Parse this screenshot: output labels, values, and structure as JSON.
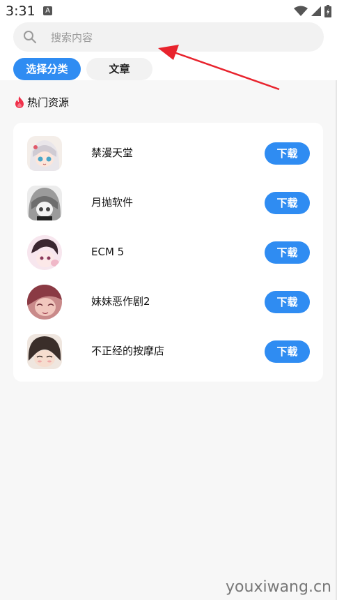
{
  "status_bar": {
    "time": "3:31",
    "notif_letter": "A"
  },
  "search": {
    "placeholder": "搜索内容",
    "value": ""
  },
  "tabs": [
    {
      "label": "选择分类",
      "active": true
    },
    {
      "label": "文章",
      "active": false
    }
  ],
  "hot": {
    "title": "热门资源",
    "items": [
      {
        "name": "禁漫天堂",
        "button": "下载"
      },
      {
        "name": "月抛软件",
        "button": "下载"
      },
      {
        "name": "ECM 5",
        "button": "下载"
      },
      {
        "name": "妹妹恶作剧2",
        "button": "下载"
      },
      {
        "name": "不正经的按摩店",
        "button": "下载"
      }
    ]
  },
  "watermark": "youxiwang.cn",
  "colors": {
    "accent": "#2f8cf2",
    "fire": "#f0304a",
    "arrow": "#e8232d"
  }
}
